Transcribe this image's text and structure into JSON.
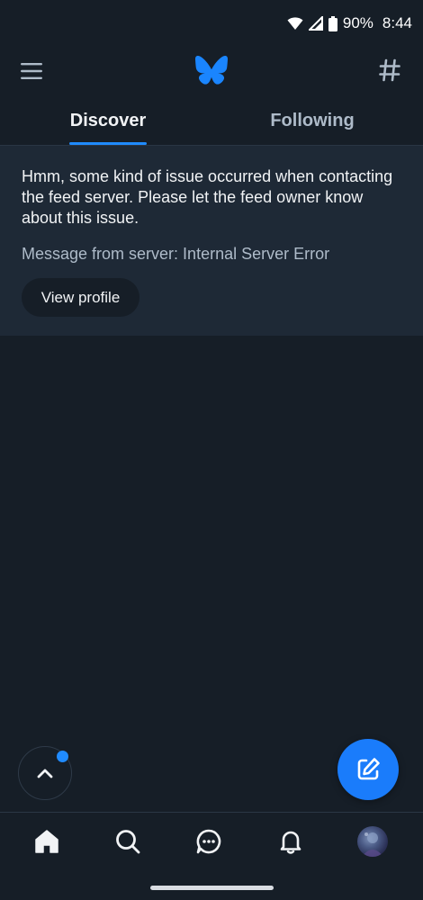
{
  "status_bar": {
    "battery": "90%",
    "time": "8:44"
  },
  "header": {
    "menu_icon": "hamburger-menu-icon",
    "logo_icon": "butterfly-logo-icon",
    "feeds_icon": "hashtag-icon"
  },
  "tabs": [
    {
      "label": "Discover",
      "active": true
    },
    {
      "label": "Following",
      "active": false
    }
  ],
  "error_card": {
    "message": "Hmm, some kind of issue occurred when contacting the feed server. Please let the feed owner know about this issue.",
    "server_message": "Message from server: Internal Server Error",
    "button_label": "View profile"
  },
  "bottom_nav": [
    "home-icon",
    "search-icon",
    "chat-icon",
    "bell-icon",
    "avatar"
  ],
  "colors": {
    "background": "#161e27",
    "card": "#1e2936",
    "accent": "#208bfe",
    "muted_text": "#aebbc9"
  }
}
